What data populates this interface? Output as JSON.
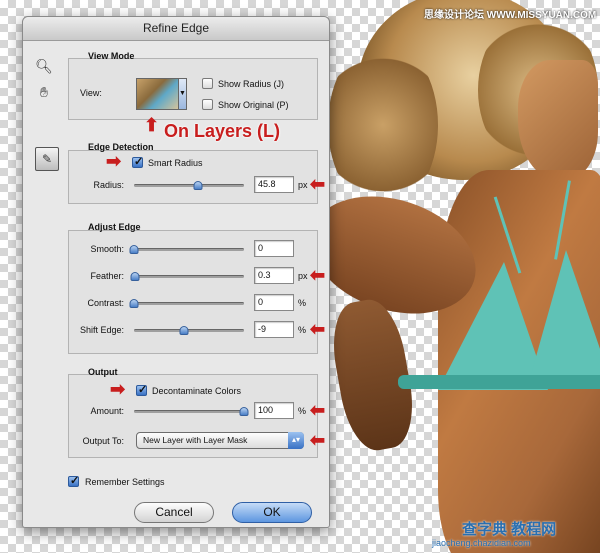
{
  "dialog": {
    "title": "Refine Edge"
  },
  "view_mode": {
    "heading": "View Mode",
    "view_label": "View:",
    "show_radius_label": "Show Radius (J)",
    "show_radius_checked": false,
    "show_original_label": "Show Original (P)",
    "show_original_checked": false
  },
  "edge_detection": {
    "heading": "Edge Detection",
    "smart_radius_label": "Smart Radius",
    "smart_radius_checked": true,
    "radius_label": "Radius:",
    "radius_value": "45.8",
    "radius_unit": "px",
    "radius_slider_fraction": 0.58
  },
  "adjust_edge": {
    "heading": "Adjust Edge",
    "smooth_label": "Smooth:",
    "smooth_value": "0",
    "smooth_slider_fraction": 0.0,
    "feather_label": "Feather:",
    "feather_value": "0.3",
    "feather_unit": "px",
    "feather_slider_fraction": 0.01,
    "contrast_label": "Contrast:",
    "contrast_value": "0",
    "contrast_unit": "%",
    "contrast_slider_fraction": 0.0,
    "shift_edge_label": "Shift Edge:",
    "shift_edge_value": "-9",
    "shift_edge_unit": "%",
    "shift_edge_slider_fraction": 0.455
  },
  "output": {
    "heading": "Output",
    "decontaminate_label": "Decontaminate Colors",
    "decontaminate_checked": true,
    "amount_label": "Amount:",
    "amount_value": "100",
    "amount_unit": "%",
    "amount_slider_fraction": 1.0,
    "output_to_label": "Output To:",
    "output_to_value": "New Layer with Layer Mask"
  },
  "remember_settings": {
    "label": "Remember Settings",
    "checked": true
  },
  "buttons": {
    "cancel": "Cancel",
    "ok": "OK"
  },
  "annotation": {
    "on_layers": "On Layers (L)"
  },
  "watermark": {
    "top_right": "思缘设计论坛 WWW.MISSYUAN.COM",
    "brand": "查字典 教程网",
    "url": "jiaocheng.chazidian.com"
  },
  "icons": {
    "zoom_tool": "magnifier-icon",
    "hand_tool": "hand-icon",
    "refine_brush_tool": "refine-brush-icon"
  },
  "colors": {
    "annotation_red": "#c81e1e",
    "bikini": "#5fc2b6"
  }
}
